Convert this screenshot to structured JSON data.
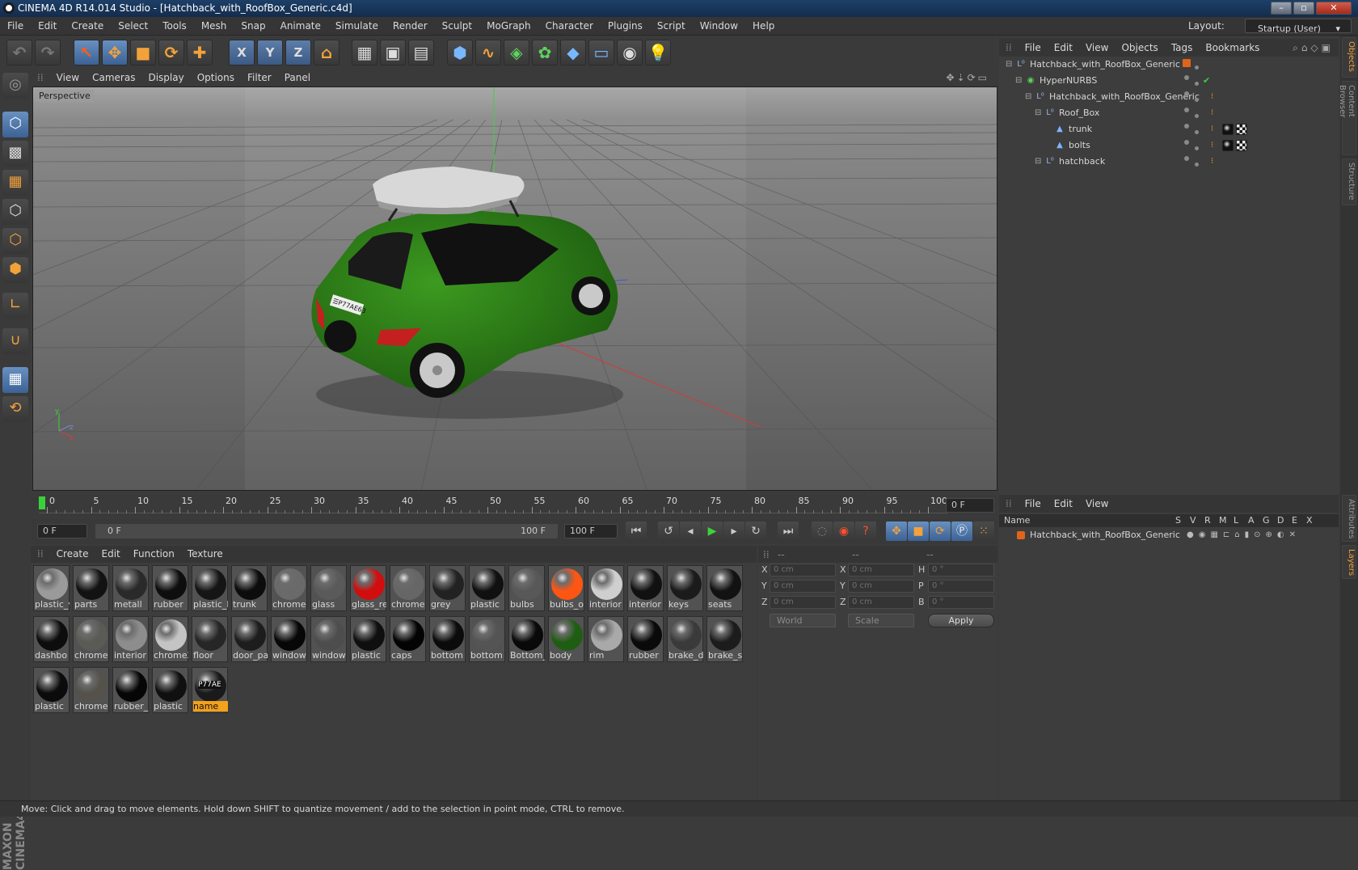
{
  "window": {
    "title": "CINEMA 4D R14.014 Studio - [Hatchback_with_RoofBox_Generic.c4d]",
    "controls": [
      "–",
      "▫",
      "✕"
    ]
  },
  "menubar": {
    "items": [
      "File",
      "Edit",
      "Create",
      "Select",
      "Tools",
      "Mesh",
      "Snap",
      "Animate",
      "Simulate",
      "Render",
      "Sculpt",
      "MoGraph",
      "Character",
      "Plugins",
      "Script",
      "Window",
      "Help"
    ],
    "layout_label": "Layout:",
    "layout_value": "Startup (User)"
  },
  "toolbar": {
    "axis": [
      "X",
      "Y",
      "Z"
    ]
  },
  "viewport": {
    "menu": [
      "View",
      "Cameras",
      "Display",
      "Options",
      "Filter",
      "Panel"
    ],
    "label": "Perspective",
    "plate_text": "☰P77AE63"
  },
  "timeline": {
    "ticks": [
      "0",
      "5",
      "10",
      "15",
      "20",
      "25",
      "30",
      "35",
      "40",
      "45",
      "50",
      "55",
      "60",
      "65",
      "70",
      "75",
      "80",
      "85",
      "90",
      "95",
      "100"
    ],
    "current_frame": "0 F",
    "start_frame": "0 F",
    "range_start": "0 F",
    "range_end": "100 F",
    "end_frame": "100 F"
  },
  "materials": {
    "menu": [
      "Create",
      "Edit",
      "Function",
      "Texture"
    ],
    "rows": [
      [
        {
          "label": "plastic_v",
          "color": "#9a9a9a"
        },
        {
          "label": "parts",
          "color": "#121212"
        },
        {
          "label": "metall",
          "color": "#2a2a2a"
        },
        {
          "label": "rubber",
          "color": "#0e0e0e"
        },
        {
          "label": "plastic_l",
          "color": "#151515"
        },
        {
          "label": "trunk",
          "color": "#0c0c0c"
        },
        {
          "label": "chrome",
          "color": "#6a6a6a"
        },
        {
          "label": "glass",
          "color": "#5a5a5a"
        },
        {
          "label": "glass_re",
          "color": "#d10d0d"
        },
        {
          "label": "chrome",
          "color": "#666666"
        },
        {
          "label": "grey",
          "color": "#222222"
        },
        {
          "label": "plastic",
          "color": "#101010"
        },
        {
          "label": "bulbs",
          "color": "#585858"
        },
        {
          "label": "bulbs_o",
          "color": "#ff5512"
        },
        {
          "label": "interior",
          "color": "#cfcfcf"
        },
        {
          "label": "interior",
          "color": "#111111"
        },
        {
          "label": "keys",
          "color": "#1b1b1b"
        },
        {
          "label": "seats",
          "color": "#121212"
        }
      ],
      [
        {
          "label": "dashbo",
          "color": "#0d0d0d"
        },
        {
          "label": "chrome",
          "color": "#5b5b55"
        },
        {
          "label": "interior",
          "color": "#8d8d8d"
        },
        {
          "label": "chrome2",
          "color": "#c4c4c4"
        },
        {
          "label": "floor",
          "color": "#262626"
        },
        {
          "label": "door_pa",
          "color": "#1d1d1d"
        },
        {
          "label": "window",
          "color": "#070707"
        },
        {
          "label": "window",
          "color": "#4d4d4d"
        },
        {
          "label": "plastic",
          "color": "#0f0f0f"
        },
        {
          "label": "caps",
          "color": "#030303"
        },
        {
          "label": "bottom",
          "color": "#0b0b0b"
        },
        {
          "label": "bottom",
          "color": "#545454"
        },
        {
          "label": "Bottom_",
          "color": "#090909"
        },
        {
          "label": "body",
          "color": "#1f5e12"
        },
        {
          "label": "rim",
          "color": "#a9a9a9"
        },
        {
          "label": "rubber",
          "color": "#0a0a0a"
        },
        {
          "label": "brake_d",
          "color": "#3a3a3a"
        },
        {
          "label": "brake_s",
          "color": "#1c1c1c"
        }
      ],
      [
        {
          "label": "plastic",
          "color": "#0b0b0b"
        },
        {
          "label": "chrome",
          "color": "#54524a"
        },
        {
          "label": "rubber_",
          "color": "#060606"
        },
        {
          "label": "plastic",
          "color": "#101010"
        },
        {
          "label": "name",
          "color": "#1a1a1a",
          "active": true,
          "ball_text": "P77AE"
        }
      ]
    ]
  },
  "coordinates": {
    "headers": [
      "--",
      "--",
      "--"
    ],
    "rows": [
      {
        "a": "X",
        "av": "0 cm",
        "b": "X",
        "bv": "0 cm",
        "c": "H",
        "cv": "0 °"
      },
      {
        "a": "Y",
        "av": "0 cm",
        "b": "Y",
        "bv": "0 cm",
        "c": "P",
        "cv": "0 °"
      },
      {
        "a": "Z",
        "av": "0 cm",
        "b": "Z",
        "bv": "0 cm",
        "c": "B",
        "cv": "0 °"
      }
    ],
    "mode1": "World",
    "mode2": "Scale",
    "apply": "Apply"
  },
  "objects": {
    "menu": [
      "File",
      "Edit",
      "View",
      "Objects",
      "Tags",
      "Bookmarks"
    ],
    "tree": [
      {
        "name": "Hatchback_with_RoofBox_Generic",
        "depth": 0,
        "icon": "null-icon"
      },
      {
        "name": "HyperNURBS",
        "depth": 1,
        "icon": "hypernurbs-icon"
      },
      {
        "name": "Hatchback_with_RoofBox_Generic",
        "depth": 2,
        "icon": "null-icon"
      },
      {
        "name": "Roof_Box",
        "depth": 3,
        "icon": "null-icon"
      },
      {
        "name": "trunk",
        "depth": 4,
        "icon": "polygon-icon"
      },
      {
        "name": "bolts",
        "depth": 4,
        "icon": "polygon-icon"
      },
      {
        "name": "hatchback",
        "depth": 3,
        "icon": "null-icon"
      }
    ]
  },
  "layers": {
    "menu": [
      "File",
      "Edit",
      "View"
    ],
    "columns": [
      "Name",
      "S",
      "V",
      "R",
      "M",
      "L",
      "A",
      "G",
      "D",
      "E",
      "X"
    ],
    "rows": [
      {
        "name": "Hatchback_with_RoofBox_Generic",
        "color": "#e0651a"
      }
    ]
  },
  "side_tabs": [
    "Objects",
    "Content Browser",
    "Structure",
    "Attributes",
    "Layers"
  ],
  "brand": "MAXON CINEMA4D",
  "status": "Move: Click and drag to move elements. Hold down SHIFT to quantize movement / add to the selection in point mode, CTRL to remove."
}
